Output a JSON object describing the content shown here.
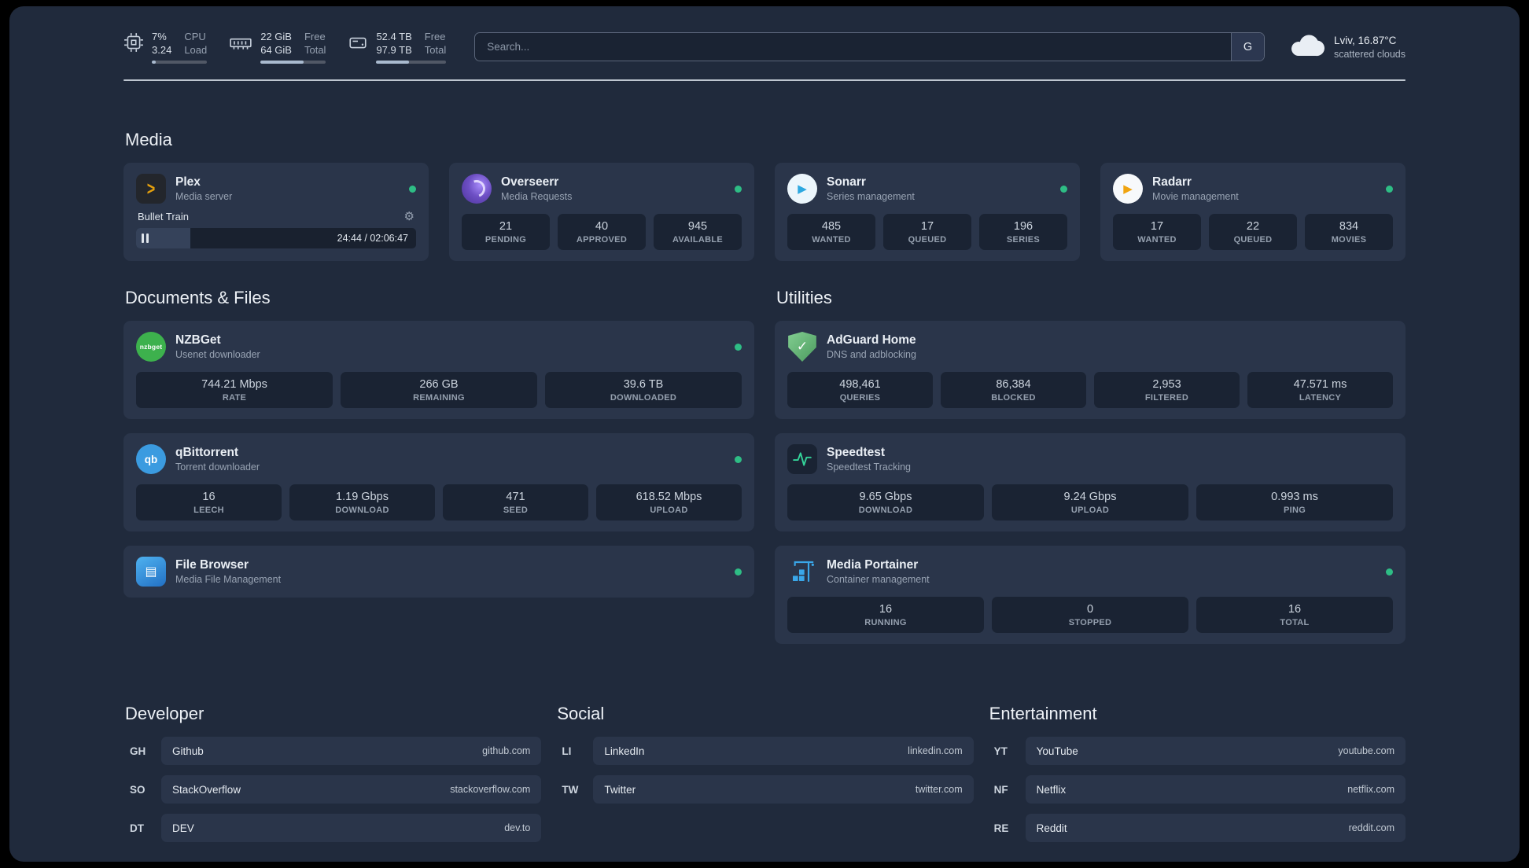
{
  "colors": {
    "status_ok": "#2ebd85",
    "page_bg": "#202a3c",
    "card_bg": "#2a354a",
    "stat_bg": "#1a2333",
    "plex_amber": "#e5a00d",
    "overseerr_purple": "#6d4fc4",
    "sonarr_blue": "#2da8e0",
    "radarr_amber": "#f0a410",
    "nzbget_green": "#3db14d",
    "qbittorrent_blue": "#3b9be0",
    "filebrowser_blue": "#2e8fe0",
    "adguard_green": "#67b279",
    "speedtest_green": "#34d399",
    "portainer_blue": "#3aa7e9"
  },
  "top_bar": {
    "cpu": {
      "value_top": "7%",
      "value_bottom": "3.24",
      "label_top": "CPU",
      "label_bottom": "Load",
      "bar_pct": 7
    },
    "memory": {
      "value_top": "22 GiB",
      "value_bottom": "64 GiB",
      "label_top": "Free",
      "label_bottom": "Total",
      "bar_pct": 66
    },
    "disk": {
      "value_top": "52.4 TB",
      "value_bottom": "97.9 TB",
      "label_top": "Free",
      "label_bottom": "Total",
      "bar_pct": 47
    },
    "search": {
      "placeholder": "Search...",
      "provider_label": "G"
    },
    "weather": {
      "location": "Lviv, 16.87°C",
      "condition": "scattered clouds"
    }
  },
  "sections": {
    "media": {
      "title": "Media",
      "services": {
        "plex": {
          "name": "Plex",
          "desc": "Media server",
          "player_title": "Bullet Train",
          "player_time": "24:44 / 02:06:47",
          "progress_pct": 19.5
        },
        "overseerr": {
          "name": "Overseerr",
          "desc": "Media Requests",
          "stats": [
            {
              "value": "21",
              "label": "PENDING"
            },
            {
              "value": "40",
              "label": "APPROVED"
            },
            {
              "value": "945",
              "label": "AVAILABLE"
            }
          ]
        },
        "sonarr": {
          "name": "Sonarr",
          "desc": "Series management",
          "stats": [
            {
              "value": "485",
              "label": "WANTED"
            },
            {
              "value": "17",
              "label": "QUEUED"
            },
            {
              "value": "196",
              "label": "SERIES"
            }
          ]
        },
        "radarr": {
          "name": "Radarr",
          "desc": "Movie management",
          "stats": [
            {
              "value": "17",
              "label": "WANTED"
            },
            {
              "value": "22",
              "label": "QUEUED"
            },
            {
              "value": "834",
              "label": "MOVIES"
            }
          ]
        }
      }
    },
    "documents": {
      "title": "Documents & Files",
      "services": {
        "nzbget": {
          "name": "NZBGet",
          "desc": "Usenet downloader",
          "icon_text": "nzbget",
          "stats": [
            {
              "value": "744.21 Mbps",
              "label": "RATE"
            },
            {
              "value": "266 GB",
              "label": "REMAINING"
            },
            {
              "value": "39.6 TB",
              "label": "DOWNLOADED"
            }
          ]
        },
        "qbittorrent": {
          "name": "qBittorrent",
          "desc": "Torrent downloader",
          "icon_text": "qb",
          "stats": [
            {
              "value": "16",
              "label": "LEECH"
            },
            {
              "value": "1.19 Gbps",
              "label": "DOWNLOAD"
            },
            {
              "value": "471",
              "label": "SEED"
            },
            {
              "value": "618.52 Mbps",
              "label": "UPLOAD"
            }
          ]
        },
        "filebrowser": {
          "name": "File Browser",
          "desc": "Media File Management"
        }
      }
    },
    "utilities": {
      "title": "Utilities",
      "services": {
        "adguard": {
          "name": "AdGuard Home",
          "desc": "DNS and adblocking",
          "stats": [
            {
              "value": "498,461",
              "label": "QUERIES"
            },
            {
              "value": "86,384",
              "label": "BLOCKED"
            },
            {
              "value": "2,953",
              "label": "FILTERED"
            },
            {
              "value": "47.571 ms",
              "label": "LATENCY"
            }
          ]
        },
        "speedtest": {
          "name": "Speedtest",
          "desc": "Speedtest Tracking",
          "stats": [
            {
              "value": "9.65 Gbps",
              "label": "DOWNLOAD"
            },
            {
              "value": "9.24 Gbps",
              "label": "UPLOAD"
            },
            {
              "value": "0.993 ms",
              "label": "PING"
            }
          ]
        },
        "portainer": {
          "name": "Media Portainer",
          "desc": "Container management",
          "stats": [
            {
              "value": "16",
              "label": "RUNNING"
            },
            {
              "value": "0",
              "label": "STOPPED"
            },
            {
              "value": "16",
              "label": "TOTAL"
            }
          ]
        }
      }
    }
  },
  "bookmarks": {
    "developer": {
      "title": "Developer",
      "items": [
        {
          "abbr": "GH",
          "name": "Github",
          "domain": "github.com"
        },
        {
          "abbr": "SO",
          "name": "StackOverflow",
          "domain": "stackoverflow.com"
        },
        {
          "abbr": "DT",
          "name": "DEV",
          "domain": "dev.to"
        }
      ]
    },
    "social": {
      "title": "Social",
      "items": [
        {
          "abbr": "LI",
          "name": "LinkedIn",
          "domain": "linkedin.com"
        },
        {
          "abbr": "TW",
          "name": "Twitter",
          "domain": "twitter.com"
        }
      ]
    },
    "entertainment": {
      "title": "Entertainment",
      "items": [
        {
          "abbr": "YT",
          "name": "YouTube",
          "domain": "youtube.com"
        },
        {
          "abbr": "NF",
          "name": "Netflix",
          "domain": "netflix.com"
        },
        {
          "abbr": "RE",
          "name": "Reddit",
          "domain": "reddit.com"
        }
      ]
    }
  }
}
